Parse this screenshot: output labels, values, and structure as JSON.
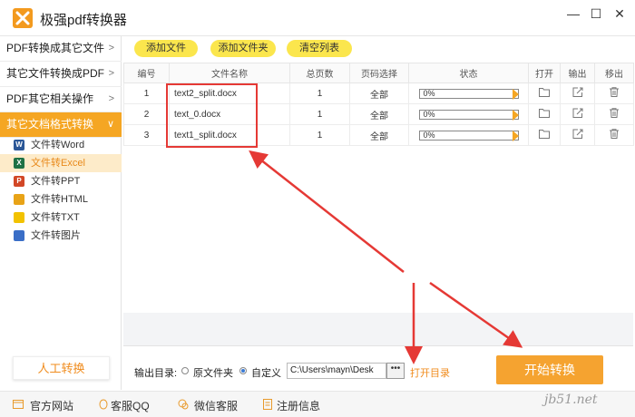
{
  "app": {
    "title": "极强pdf转换器"
  },
  "window_controls": {
    "minimize": "—",
    "maximize": "☐",
    "close": "✕"
  },
  "sidebar": {
    "items": [
      {
        "label": "PDF转换成其它文件",
        "chevron": ">"
      },
      {
        "label": "其它文件转换成PDF",
        "chevron": ">"
      },
      {
        "label": "PDF其它相关操作",
        "chevron": ">"
      },
      {
        "label": "其它文档格式转换",
        "chevron": "∨"
      }
    ],
    "subitems": [
      {
        "label": "文件转Word",
        "icon": "word-icon",
        "icon_text": "W",
        "color": "#2b5797"
      },
      {
        "label": "文件转Excel",
        "icon": "excel-icon",
        "icon_text": "X",
        "color": "#1e7145"
      },
      {
        "label": "文件转PPT",
        "icon": "ppt-icon",
        "icon_text": "P",
        "color": "#d24726"
      },
      {
        "label": "文件转HTML",
        "icon": "html-icon",
        "icon_text": "",
        "color": "#e8a317"
      },
      {
        "label": "文件转TXT",
        "icon": "txt-icon",
        "icon_text": "",
        "color": "#f2c200"
      },
      {
        "label": "文件转图片",
        "icon": "image-icon",
        "icon_text": "",
        "color": "#3a6ec7"
      }
    ],
    "manual_button": "人工转换"
  },
  "toolbar": {
    "add_file": "添加文件",
    "add_folder": "添加文件夹",
    "clear_list": "清空列表"
  },
  "table": {
    "headers": [
      "编号",
      "文件名称",
      "总页数",
      "页码选择",
      "状态",
      "打开",
      "输出",
      "移出"
    ],
    "rows": [
      {
        "num": "1",
        "name": "text2_split.docx",
        "pages": "1",
        "range": "全部",
        "status": "0%"
      },
      {
        "num": "2",
        "name": "text_0.docx",
        "pages": "1",
        "range": "全部",
        "status": "0%"
      },
      {
        "num": "3",
        "name": "text1_split.docx",
        "pages": "1",
        "range": "全部",
        "status": "0%"
      }
    ]
  },
  "output": {
    "label": "输出目录:",
    "option_source": "原文件夹",
    "option_custom": "自定义",
    "selected": "自定义",
    "path": "C:\\Users\\mayn\\Desk",
    "browse": "•••",
    "open_dir": "打开目录",
    "start": "开始转换"
  },
  "footer": {
    "items": [
      {
        "label": "官方网站",
        "icon": "home-icon"
      },
      {
        "label": "客服QQ",
        "icon": "qq-icon"
      },
      {
        "label": "微信客服",
        "icon": "wechat-icon"
      },
      {
        "label": "注册信息",
        "icon": "register-icon"
      }
    ],
    "watermark": "jb51.net"
  },
  "colors": {
    "accent": "#f5a623",
    "toolbar_button": "#fbe64d",
    "highlight_box": "#e53935",
    "arrow": "#e53935",
    "start_button": "#f5a330"
  }
}
